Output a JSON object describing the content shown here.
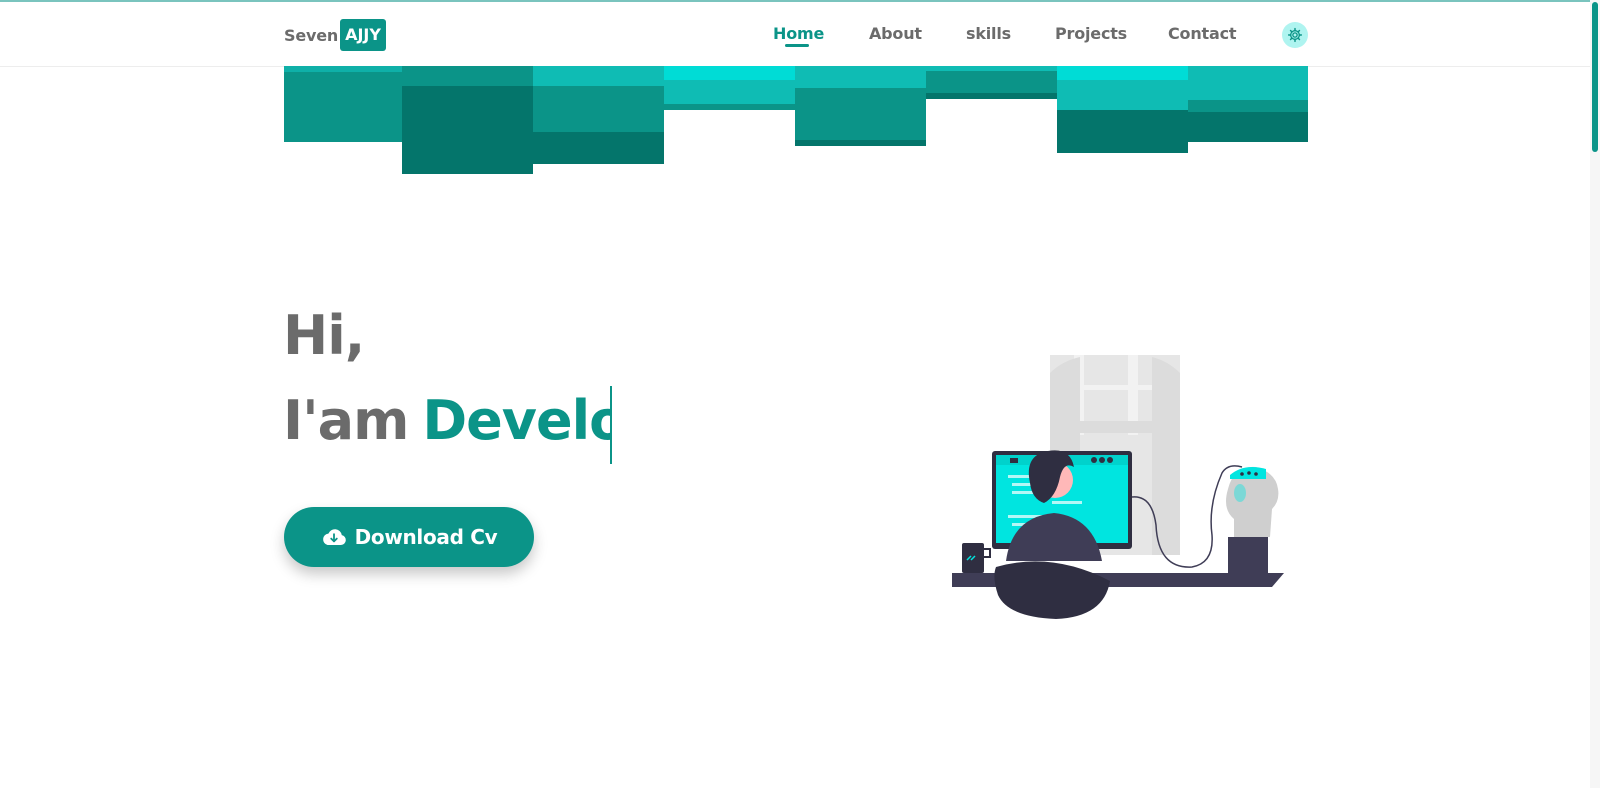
{
  "header": {
    "logo_text": "Seven",
    "logo_badge": "AJJY",
    "nav": [
      {
        "label": "Home",
        "active": true
      },
      {
        "label": "About",
        "active": false
      },
      {
        "label": "skills",
        "active": false
      },
      {
        "label": "Projects",
        "active": false
      },
      {
        "label": "Contact",
        "active": false
      }
    ],
    "theme_toggle_icon": "gear-icon"
  },
  "hero": {
    "greeting": "Hi,",
    "intro_prefix": "I'am",
    "typed_role": "Develo",
    "cv_button_label": "Download Cv",
    "cv_button_icon": "cloud-download-icon"
  },
  "colors": {
    "accent": "#0b9488",
    "accent_dark": "#04756b",
    "accent_light": "#0fbcb4",
    "cyan": "#00e5e0",
    "text": "#6b6b6b"
  }
}
